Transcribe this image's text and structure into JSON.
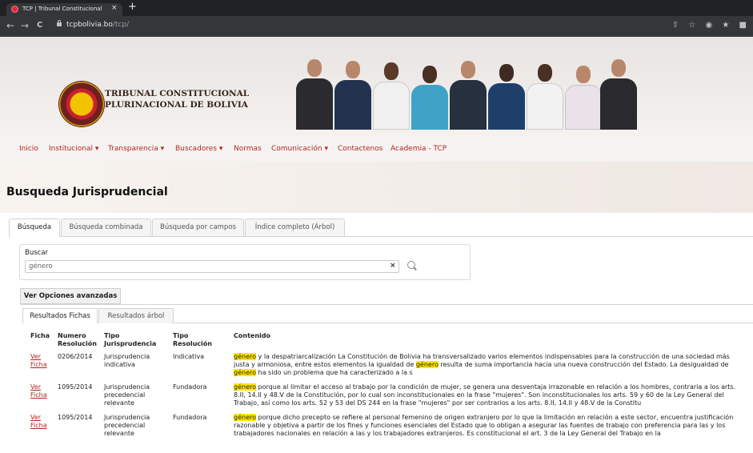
{
  "browser": {
    "tab_title": "TCP | Tribunal Constitucional P",
    "close_glyph": "×",
    "new_tab_glyph": "+",
    "back_glyph": "←",
    "forward_glyph": "→",
    "reload_glyph": "C",
    "url_host": "tcpbolivia.bo",
    "url_path": "/tcp/",
    "toolbar_icons": [
      "share-icon",
      "bookmark-star-icon",
      "extension-icon",
      "puzzle-icon",
      "sidebar-icon"
    ],
    "toolbar_glyphs": [
      "⇧",
      "☆",
      "◉",
      "★",
      "■"
    ]
  },
  "site": {
    "name_line1": "TRIBUNAL CONSTITUCIONAL",
    "name_line2": "PLURINACIONAL DE BOLIVIA",
    "nav": [
      "Inicio",
      "Institucional ▾",
      "Transparencia ▾",
      "Buscadores ▾",
      "Normas",
      "Comunicación ▾",
      "Contactenos",
      "Academia - TCP"
    ],
    "accent": "#b3261e"
  },
  "page": {
    "title": "Busqueda Jurisprudencial"
  },
  "search_tabs": [
    "Búsqueda",
    "Búsqueda combinada",
    "Búsqueda por campos",
    "Índice completo (Árbol)"
  ],
  "search": {
    "label": "Buscar",
    "value": "género",
    "clear_glyph": "×"
  },
  "advanced_button": "Ver Opciones avanzadas",
  "result_tabs": [
    "Resultados Fichas",
    "Resultados árbol"
  ],
  "results": {
    "headers": {
      "ficha": "Ficha",
      "numero": "Numero Resolución",
      "tipo_juris": "Tipo Jurisprudencia",
      "tipo_res": "Tipo Resolución",
      "contenido": "Contenido"
    },
    "rows": [
      {
        "link": "Ver Ficha",
        "numero": "0206/2014",
        "tipo_juris": "Jurisprudencia indicativa",
        "tipo_res": "Indicativa",
        "c_a": "género",
        "c_b": " y la despatriarcalización La Constitución de Bolivia ha transversalizado varios elementos indispensables para la construcción de una sociedad más justa y armoniosa, entre estos elementos la igualdad de ",
        "c_c": "género",
        "c_d": " resulta de suma importancia hacia una nueva construcción del Estado. La desigualdad de ",
        "c_e": "género",
        "c_f": " ha sido un problema que ha caracterizado a la s"
      },
      {
        "link": "Ver Ficha",
        "numero": "1095/2014",
        "tipo_juris": "Jurisprudencia precedencial relevante",
        "tipo_res": "Fundadora",
        "c_a": "género",
        "c_b": " porque al limitar el acceso al trabajo por la condición de mujer, se genera una desventaja irrazonable en relación a los hombres, contraria a los arts. 8.II, 14.II y 48.V de la Constitución, por lo cual son inconstitucionales en la frase \"mujeres\". Son inconstitucionales los arts. 59 y 60 de la Ley General del Trabajo, así como los arts. 52 y 53 del DS 244 en la frase \"mujeres\" por ser contrarios a los arts. 8.II, 14.II y 48.V de la Constitu"
      },
      {
        "link": "Ver Ficha",
        "numero": "1095/2014",
        "tipo_juris": "Jurisprudencia precedencial relevante",
        "tipo_res": "Fundadora",
        "c_a": "género",
        "c_b": " porque dicho precepto se refiere al personal femenino de origen extranjero por lo que la limitación en relación a este sector, encuentra justificación razonable y objetiva a partir de los fines y funciones esenciales del Estado que lo obligan a asegurar las fuentes de trabajo con preferencia para las y los trabajadores nacionales en relación a las y los trabajadores extranjeros. Es constitucional el art. 3 de la Ley General del Trabajo en la"
      }
    ]
  }
}
